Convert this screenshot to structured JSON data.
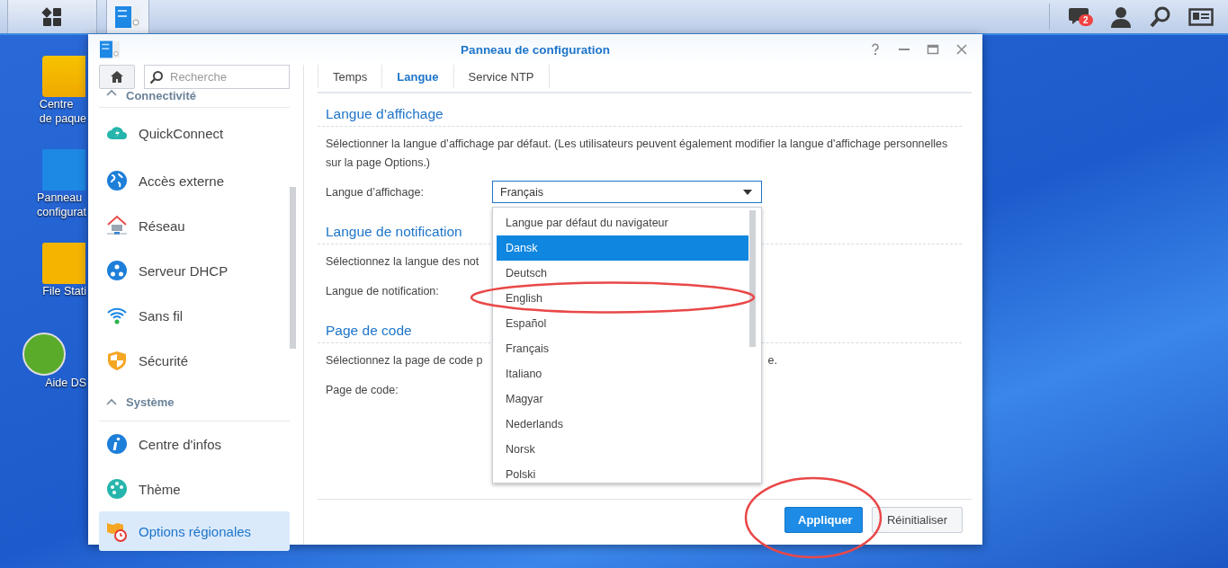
{
  "taskbar": {
    "notification_count": "2"
  },
  "desktop_icons": [
    {
      "lines": [
        "Centre",
        "de paque"
      ]
    },
    {
      "lines": [
        "Panneau",
        "configurat"
      ]
    },
    {
      "lines": [
        "File Stati"
      ]
    },
    {
      "lines": [
        "Aide DS"
      ]
    }
  ],
  "window": {
    "title": "Panneau de configuration",
    "search": {
      "placeholder": "Recherche"
    },
    "sidebar": [
      {
        "kind": "header",
        "label": "Connectivité"
      },
      {
        "kind": "item",
        "label": "QuickConnect",
        "selected": false
      },
      {
        "kind": "item",
        "label": "Accès externe",
        "selected": false
      },
      {
        "kind": "item",
        "label": "Réseau",
        "selected": false
      },
      {
        "kind": "item",
        "label": "Serveur DHCP",
        "selected": false
      },
      {
        "kind": "item",
        "label": "Sans fil",
        "selected": false
      },
      {
        "kind": "item",
        "label": "Sécurité",
        "selected": false
      },
      {
        "kind": "header",
        "label": "Système"
      },
      {
        "kind": "item",
        "label": "Centre d'infos",
        "selected": false
      },
      {
        "kind": "item",
        "label": "Thème",
        "selected": false
      },
      {
        "kind": "item",
        "label": "Options régionales",
        "selected": true
      }
    ],
    "tabs": [
      {
        "label": "Temps",
        "selected": false
      },
      {
        "label": "Langue",
        "selected": true
      },
      {
        "label": "Service NTP",
        "selected": false
      }
    ],
    "sections": [
      {
        "heading": "Langue d’affichage",
        "description": "Sélectionner la langue d’affichage par défaut. (Les utilisateurs peuvent également modifier la langue d'affichage personnelles sur la page Options.)",
        "field_label": "Langue d’affichage:",
        "value": "Français"
      },
      {
        "heading": "Langue de notification",
        "description": "Sélectionnez la langue des not",
        "field_label": "Langue de notification:"
      },
      {
        "heading": "Page de code",
        "description": "Sélectionnez la page de code p",
        "description_tail": "e.",
        "field_label": "Page de code:"
      }
    ],
    "dropdown_options": [
      {
        "label": "Langue par défaut du navigateur",
        "selected": false
      },
      {
        "label": "Dansk",
        "selected": true
      },
      {
        "label": "Deutsch",
        "selected": false
      },
      {
        "label": "English",
        "selected": false
      },
      {
        "label": "Español",
        "selected": false
      },
      {
        "label": "Français",
        "selected": false
      },
      {
        "label": "Italiano",
        "selected": false
      },
      {
        "label": "Magyar",
        "selected": false
      },
      {
        "label": "Nederlands",
        "selected": false
      },
      {
        "label": "Norsk",
        "selected": false
      },
      {
        "label": "Polski",
        "selected": false
      }
    ],
    "buttons": [
      {
        "label": "Appliquer",
        "kind": "primary"
      },
      {
        "label": "Réinitialiser",
        "kind": "secondary"
      }
    ]
  }
}
